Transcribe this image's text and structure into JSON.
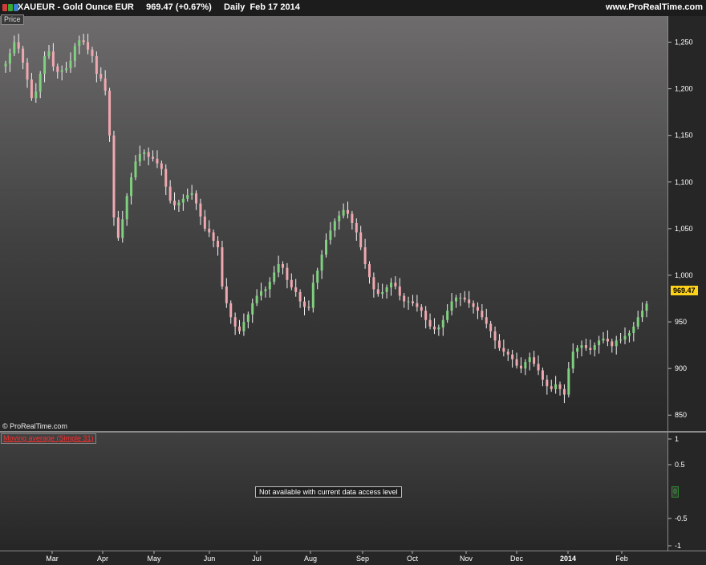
{
  "header": {
    "symbol": "XAUEUR",
    "name": "Gold Ounce EUR",
    "price": "969.47 (+0.67%)",
    "period": "Daily",
    "date": "Feb 17 2014",
    "title_text": "XAUEUR - Gold Ounce EUR     969.47 (+0.67%)     Daily  Feb 17 2014",
    "site": "www.ProRealTime.com",
    "window_button_colors": [
      "#d23b3b",
      "#38a838",
      "#3a7fd0"
    ]
  },
  "panel_label": "Price",
  "copyright": "© ProRealTime.com",
  "indicator": {
    "label": "Moving average (Simple 31)",
    "message": "Not available with current data access level",
    "y_ticks": [
      "1",
      "0.5",
      "0",
      "-0.5",
      "-1"
    ],
    "zero_marker": "0"
  },
  "last_price_label": "969.47",
  "colors": {
    "up": "#7fd07f",
    "down": "#f0a8b0",
    "wick": "#f2f2f2",
    "last_price_bg": "#ffd21a"
  },
  "chart_data": {
    "type": "candlestick",
    "title": "XAUEUR - Gold Ounce EUR",
    "ylim": [
      833,
      1278
    ],
    "y_ticks": [
      850,
      900,
      950,
      1000,
      1050,
      1100,
      1150,
      1200,
      1250
    ],
    "y_tick_labels": [
      "850",
      "900",
      "950",
      "1,000",
      "1,050",
      "1,100",
      "1,150",
      "1,200",
      "1,250"
    ],
    "x_labels": [
      "Mar",
      "Apr",
      "May",
      "Jun",
      "Jul",
      "Aug",
      "Sep",
      "Oct",
      "Nov",
      "Dec",
      "2014",
      "Feb"
    ],
    "closes": [
      1227,
      1238,
      1250,
      1243,
      1228,
      1210,
      1190,
      1197,
      1216,
      1235,
      1240,
      1224,
      1218,
      1220,
      1222,
      1230,
      1246,
      1252,
      1250,
      1242,
      1235,
      1216,
      1211,
      1198,
      1150,
      1062,
      1040,
      1060,
      1085,
      1105,
      1122,
      1130,
      1132,
      1127,
      1125,
      1120,
      1114,
      1095,
      1080,
      1075,
      1078,
      1082,
      1086,
      1088,
      1077,
      1063,
      1050,
      1046,
      1037,
      1030,
      988,
      970,
      955,
      945,
      940,
      950,
      958,
      970,
      978,
      983,
      985,
      993,
      1003,
      1012,
      1008,
      995,
      987,
      982,
      972,
      966,
      965,
      992,
      1005,
      1022,
      1038,
      1048,
      1058,
      1064,
      1070,
      1066,
      1056,
      1046,
      1030,
      1012,
      998,
      985,
      980,
      982,
      987,
      992,
      988,
      978,
      972,
      972,
      970,
      966,
      962,
      952,
      945,
      942,
      944,
      952,
      962,
      972,
      976,
      976,
      974,
      970,
      966,
      962,
      955,
      948,
      940,
      930,
      922,
      918,
      915,
      910,
      903,
      900,
      907,
      912,
      905,
      898,
      888,
      881,
      878,
      883,
      878,
      872,
      900,
      918,
      922,
      925,
      922,
      920,
      925,
      930,
      932,
      929,
      924,
      930,
      931,
      935,
      938,
      945,
      955,
      962,
      969.47
    ]
  }
}
